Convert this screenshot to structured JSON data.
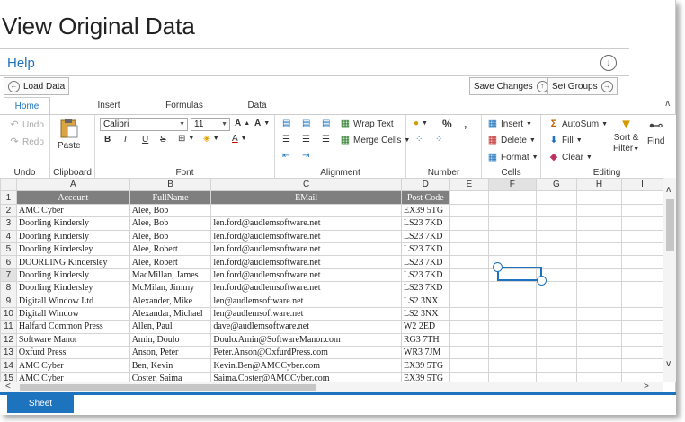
{
  "page": {
    "title": "View Original Data",
    "help": "Help"
  },
  "toolbar": {
    "load_data": "Load Data",
    "save_changes": "Save Changes",
    "set_groups": "Set Groups"
  },
  "tabs": [
    "Home",
    "Insert",
    "Formulas",
    "Data"
  ],
  "ribbon": {
    "undo": {
      "undo": "Undo",
      "redo": "Redo",
      "label": "Undo"
    },
    "clipboard": {
      "paste": "Paste",
      "label": "Clipboard"
    },
    "font": {
      "family": "Calibri",
      "size": "11",
      "label": "Font"
    },
    "alignment": {
      "wrap": "Wrap Text",
      "merge": "Merge Cells",
      "label": "Alignment"
    },
    "number": {
      "percent": "%",
      "comma": ",",
      "label": "Number"
    },
    "cells": {
      "insert": "Insert",
      "delete": "Delete",
      "format": "Format",
      "label": "Cells"
    },
    "editing": {
      "autosum": "AutoSum",
      "fill": "Fill",
      "clear": "Clear",
      "sort": "Sort &",
      "filter": "Filter",
      "find": "Find",
      "label": "Editing"
    }
  },
  "grid": {
    "columns": [
      "A",
      "B",
      "C",
      "D",
      "E",
      "F",
      "G",
      "H",
      "I"
    ],
    "selected_column": "F",
    "selected_row": "7",
    "header": [
      "Account",
      "FullName",
      "EMail",
      "Post Code"
    ],
    "rows": [
      [
        "AMC Cyber",
        "Alee, Bob",
        "",
        "EX39 5TG"
      ],
      [
        "Doorling Kindersly",
        "Alee, Bob",
        "len.ford@audlemsoftware.net",
        "LS23 7KD"
      ],
      [
        "Doorling Kindersly",
        "Alee, Bob",
        "len.ford@audlemsoftware.net",
        "LS23 7KD"
      ],
      [
        "Doorling Kindersley",
        "Alee, Robert",
        "len.ford@audlemsoftware.net",
        "LS23 7KD"
      ],
      [
        "DOORLING Kindersley",
        "Alee, Robert",
        "len.ford@audlemsoftware.net",
        "LS23 7KD"
      ],
      [
        "Doorling Kindersly",
        "MacMillan, James",
        "len.ford@audlemsoftware.net",
        "LS23 7KD"
      ],
      [
        "Doorling Kindersley",
        "McMilan, Jimmy",
        "len.ford@audlemsoftware.net",
        "LS23 7KD"
      ],
      [
        "Digitall Window Ltd",
        "Alexander, Mike",
        "len@audlemsoftware.net",
        "LS2 3NX"
      ],
      [
        "Digitall Window",
        "Alexandar, Michael",
        "len@audlemsoftware.net",
        "LS2 3NX"
      ],
      [
        "Halfard Common Press",
        "Allen, Paul",
        "dave@audlemsoftware.net",
        "W2 2ED"
      ],
      [
        "Software Manor",
        "Amin, Doulo",
        "Doulo.Amin@SoftwareManor.com",
        "RG3 7TH"
      ],
      [
        "Oxfurd Press",
        "Anson, Peter",
        "Peter.Anson@OxfurdPress.com",
        "WR3 7JM"
      ],
      [
        "AMC Cyber",
        "Ben, Kevin",
        "Kevin.Ben@AMCCyber.com",
        "EX39 5TG"
      ],
      [
        "AMC Cyber",
        "Coster, Saima",
        "Saima.Coster@AMCCyber.com",
        "EX39 5TG"
      ]
    ]
  },
  "sheet": {
    "tab": "Sheet"
  }
}
